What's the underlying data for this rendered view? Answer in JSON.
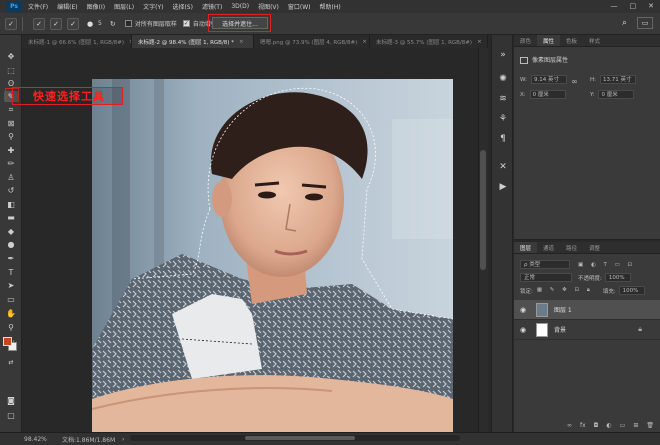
{
  "menubar": {
    "logo": "Ps",
    "items": [
      "文件(F)",
      "编辑(E)",
      "图像(I)",
      "图层(L)",
      "文字(Y)",
      "选择(S)",
      "滤镜(T)",
      "3D(D)",
      "视图(V)",
      "窗口(W)",
      "帮助(H)"
    ],
    "window_buttons": [
      "—",
      "□",
      "✕"
    ]
  },
  "options": {
    "sample_all_layers": "对所有图层取样",
    "auto_enhance": "自动增强",
    "select_and_mask": "选择并遮住...",
    "brush_size": "5"
  },
  "tabs": [
    {
      "label": "未标题-1 @ 66.6% (图层 1, RGB/8#)",
      "close": "×"
    },
    {
      "label": "未标题-2 @ 98.4% (图层 1, RGB/8) *",
      "close": "×"
    },
    {
      "label": "嗯嗯.png @ 73.9% (图层 4, RGB/8#)",
      "close": "×"
    },
    {
      "label": "未标题-3 @ 55.7% (图层 1, RGB/8#)",
      "close": "×"
    }
  ],
  "callout": {
    "text": "快速选择工具"
  },
  "status": {
    "zoom": "98.42%",
    "doc": "文档:1.86M/1.86M",
    "arrow": "›"
  },
  "properties": {
    "tabs": [
      "颜色",
      "属性",
      "色板",
      "样式"
    ],
    "title": "像素图层属性",
    "w_label": "W:",
    "w_value": "9.14 英寸",
    "h_label": "H:",
    "h_value": "13.71 英寸",
    "x_label": "X:",
    "x_value": "0 厘米",
    "y_label": "Y:",
    "y_value": "0 厘米"
  },
  "layers": {
    "tabs": [
      "图层",
      "通道",
      "路径",
      "调整"
    ],
    "filter": "ρ 类型",
    "blend_mode": "正常",
    "opacity_label": "不透明度:",
    "opacity_value": "100%",
    "lock_label": "锁定:",
    "fill_label": "填充:",
    "fill_value": "100%",
    "items": [
      {
        "name": "图层 1",
        "selected": true
      },
      {
        "name": "背景",
        "selected": false,
        "locked": true
      }
    ]
  },
  "colors": {
    "accent_red": "#e02020",
    "foreground": "#c8441c",
    "background": "#f0f0f0"
  }
}
